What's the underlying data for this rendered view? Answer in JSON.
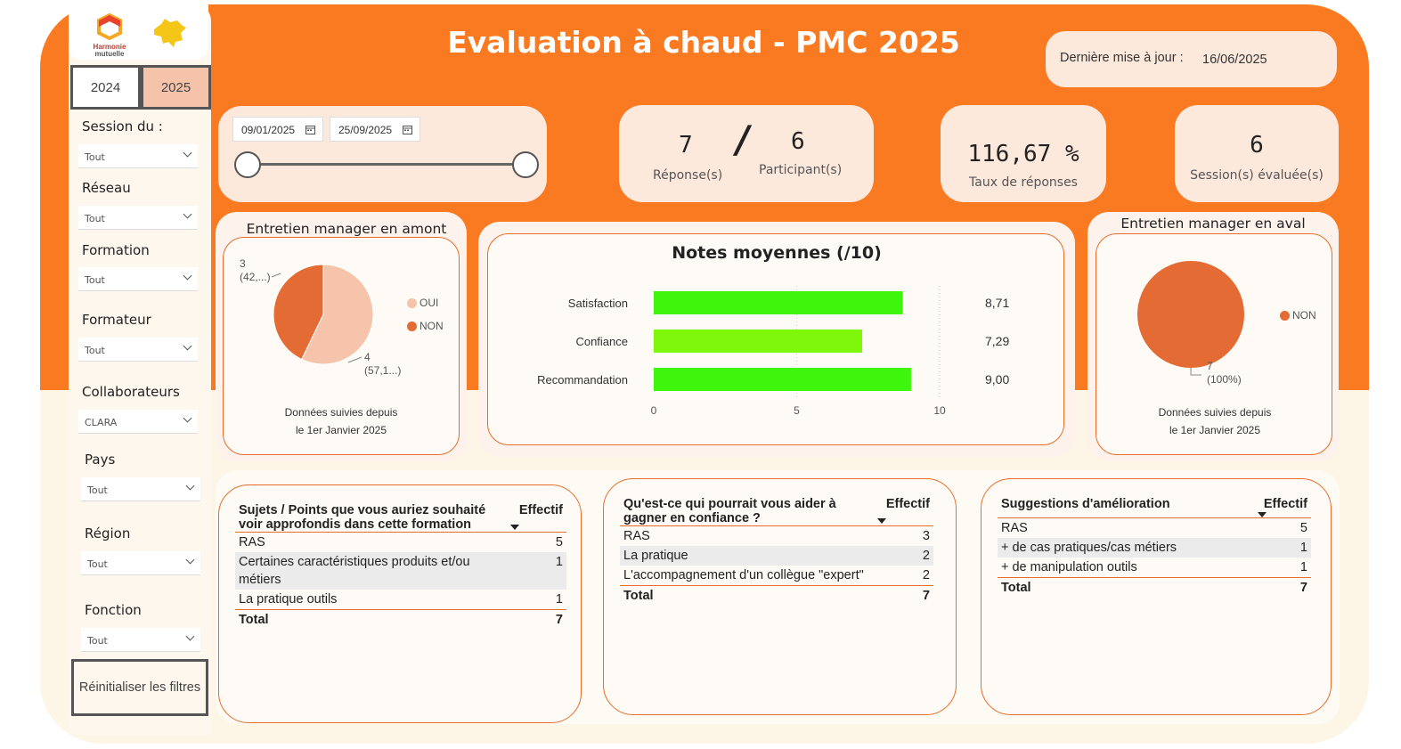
{
  "header": {
    "title": "Evaluation à chaud - PMC 2025",
    "last_update_label": "Dernière mise à jour :",
    "last_update_value": "16/06/2025"
  },
  "logo": {
    "brand_line1": "Harmonie",
    "brand_line2": "mutuelle"
  },
  "year_tabs": [
    {
      "label": "2024",
      "selected": false
    },
    {
      "label": "2025",
      "selected": true
    }
  ],
  "filters": [
    {
      "label": "Session du :",
      "value": "Tout"
    },
    {
      "label": "Réseau",
      "value": "Tout"
    },
    {
      "label": "Formation",
      "value": "Tout"
    },
    {
      "label": "Formateur",
      "value": "Tout"
    },
    {
      "label": "Collaborateurs",
      "value": "CLARA"
    },
    {
      "label": "Pays",
      "value": "Tout"
    },
    {
      "label": "Région",
      "value": "Tout"
    },
    {
      "label": "Fonction",
      "value": "Tout"
    }
  ],
  "reset_label": "Réinitialiser les filtres",
  "date_range": {
    "start": "09/01/2025",
    "end": "25/09/2025"
  },
  "kpis": {
    "responses_value": "7",
    "responses_label": "Réponse(s)",
    "separator": "/",
    "participants_value": "6",
    "participants_label": "Participant(s)",
    "rate_value": "116,67 %",
    "rate_label": "Taux de réponses",
    "sessions_value": "6",
    "sessions_label": "Session(s) évaluée(s)"
  },
  "amont": {
    "title": "Entretien manager en amont",
    "slices": [
      {
        "label": "OUI",
        "value": 4,
        "data_label": "4",
        "pct_label": "(57,1...)",
        "color": "#f5c4ab"
      },
      {
        "label": "NON",
        "value": 3,
        "data_label": "3",
        "pct_label": "(42,...)",
        "color": "#e46b33"
      }
    ],
    "note_line1": "Données suivies depuis",
    "note_line2": "le 1er Janvier 2025"
  },
  "aval": {
    "title": "Entretien manager en aval",
    "slices": [
      {
        "label": "NON",
        "value": 7,
        "data_label": "7",
        "pct_label": "(100%)",
        "color": "#e46b33"
      }
    ],
    "note_line1": "Données suivies depuis",
    "note_line2": "le 1er Janvier 2025"
  },
  "chart_data": {
    "type": "bar",
    "orientation": "horizontal",
    "title": "Notes moyennes (/10)",
    "categories": [
      "Satisfaction",
      "Confiance",
      "Recommandation"
    ],
    "values": [
      8.71,
      7.29,
      9.0
    ],
    "value_labels": [
      "8,71",
      "7,29",
      "9,00"
    ],
    "colors": [
      "#3ef50c",
      "#7ef70a",
      "#3ef50c"
    ],
    "xlim": [
      0,
      10
    ],
    "xticks": [
      "0",
      "5",
      "10"
    ],
    "grid": true
  },
  "tables": [
    {
      "header": "Sujets / Points que vous auriez souhaité voir approfondis dans cette formation",
      "count_header": "Effectif",
      "rows": [
        {
          "label": "RAS",
          "count": "5"
        },
        {
          "label": "Certaines caractéristiques produits et/ou métiers",
          "count": "1"
        },
        {
          "label": "La pratique outils",
          "count": "1"
        }
      ],
      "total_label": "Total",
      "total": "7"
    },
    {
      "header": "Qu'est-ce qui pourrait vous aider à gagner en confiance ?",
      "count_header": "Effectif",
      "rows": [
        {
          "label": "RAS",
          "count": "3"
        },
        {
          "label": "La pratique",
          "count": "2"
        },
        {
          "label": "L'accompagnement d'un collègue \"expert\"",
          "count": "2"
        }
      ],
      "total_label": "Total",
      "total": "7"
    },
    {
      "header": "Suggestions d'amélioration",
      "count_header": "Effectif",
      "rows": [
        {
          "label": "RAS",
          "count": "5"
        },
        {
          "label": "+ de cas pratiques/cas métiers",
          "count": "1"
        },
        {
          "label": "+ de manipulation outils",
          "count": "1"
        }
      ],
      "total_label": "Total",
      "total": "7"
    }
  ]
}
